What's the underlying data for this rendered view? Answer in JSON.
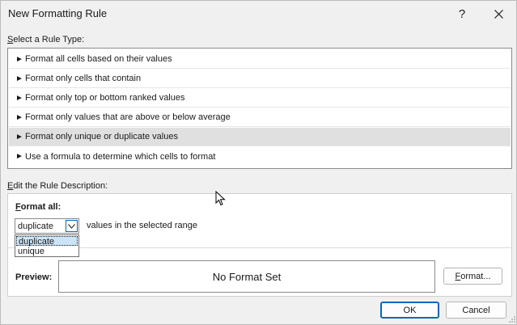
{
  "window": {
    "title": "New Formatting Rule",
    "help_label": "?"
  },
  "rule_type": {
    "label_prefix": "S",
    "label_rest": "elect a Rule Type:",
    "items": [
      {
        "label": "Format all cells based on their values",
        "selected": false
      },
      {
        "label": "Format only cells that contain",
        "selected": false
      },
      {
        "label": "Format only top or bottom ranked values",
        "selected": false
      },
      {
        "label": "Format only values that are above or below average",
        "selected": false
      },
      {
        "label": "Format only unique or duplicate values",
        "selected": true
      },
      {
        "label": "Use a formula to determine which cells to format",
        "selected": false
      }
    ],
    "arrow_glyph": "►"
  },
  "description": {
    "label_prefix": "E",
    "label_rest": "dit the Rule Description:",
    "format_all_prefix": "F",
    "format_all_rest": "ormat all:",
    "combo_value": "duplicate",
    "combo_suffix": "values in the selected range",
    "dropdown_options": [
      "duplicate",
      "unique"
    ],
    "dropdown_selected": "duplicate"
  },
  "preview": {
    "label": "Preview:",
    "text": "No Format Set"
  },
  "buttons": {
    "format_prefix": "F",
    "format_rest": "ormat...",
    "ok": "OK",
    "cancel": "Cancel"
  },
  "colors": {
    "accent": "#0067c0",
    "selected_row": "#e0e0e0",
    "dropdown_highlight": "#cce4f7"
  }
}
